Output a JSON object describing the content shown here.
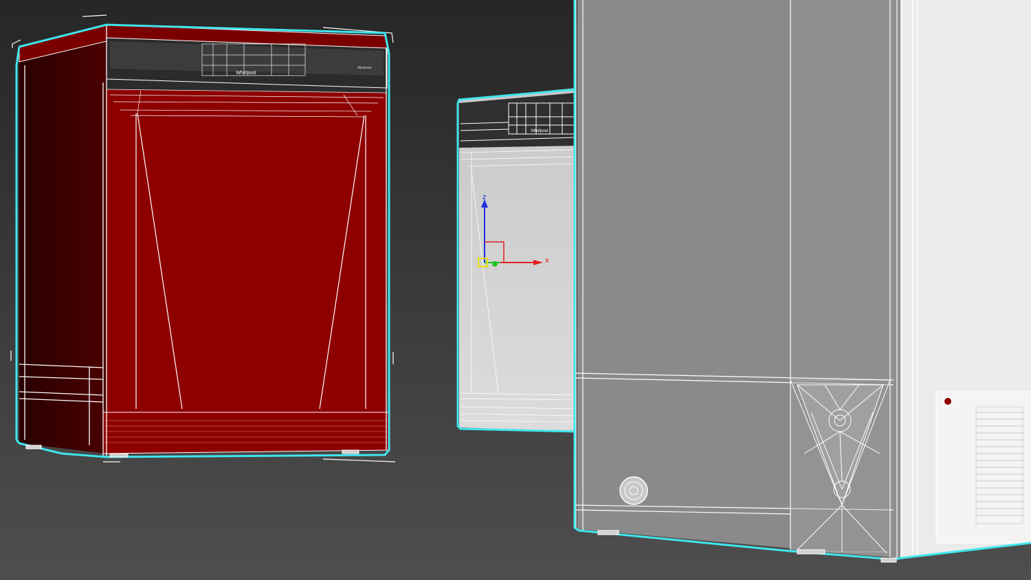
{
  "viewport": {
    "background_top": "#262626",
    "background_bottom": "#4e4e4e",
    "selection_color": "#40e6ee",
    "wire_color": "#ffffff"
  },
  "objects": [
    {
      "name": "dishwasher-red",
      "color": "#8e0000",
      "side_color": "#3a0000",
      "brand": "Whirlpool",
      "control_text": "6thsense"
    },
    {
      "name": "dishwasher-gray-mid",
      "color": "#d2d2d2",
      "brand": "Whirlpool"
    },
    {
      "name": "appliance-gray-large",
      "color": "#8a8a8a",
      "side_color": "#ececec"
    }
  ],
  "gizmo": {
    "x_label": "x",
    "z_label": "z",
    "x_color": "#e02020",
    "y_color": "#20c020",
    "z_color": "#2030e0",
    "plane_color": "#e8e000"
  }
}
